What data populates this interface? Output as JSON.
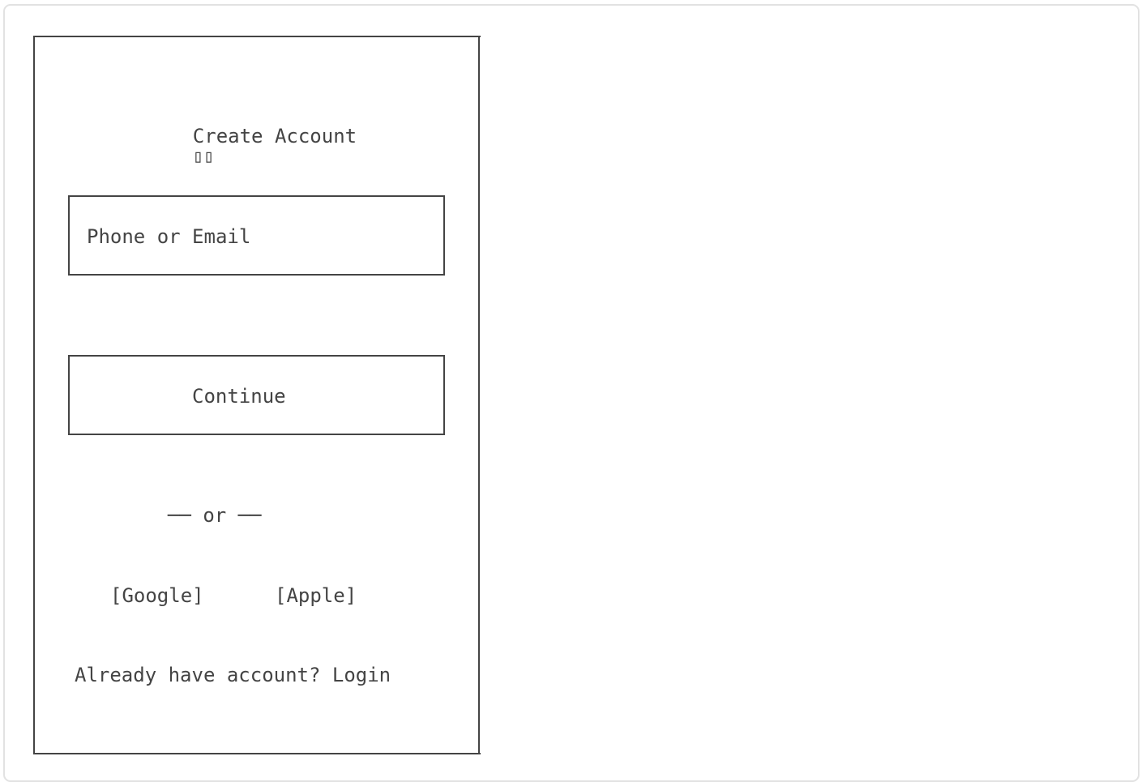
{
  "screen": {
    "title": "Create Account",
    "title_glyph": "▯▯"
  },
  "form": {
    "identifier_placeholder": "Phone or Email",
    "continue_label": "Continue",
    "divider_label": "── or ──"
  },
  "social": {
    "google_label": "[Google]",
    "apple_label": "[Apple]"
  },
  "footer": {
    "prompt": "Already have account? Login"
  }
}
